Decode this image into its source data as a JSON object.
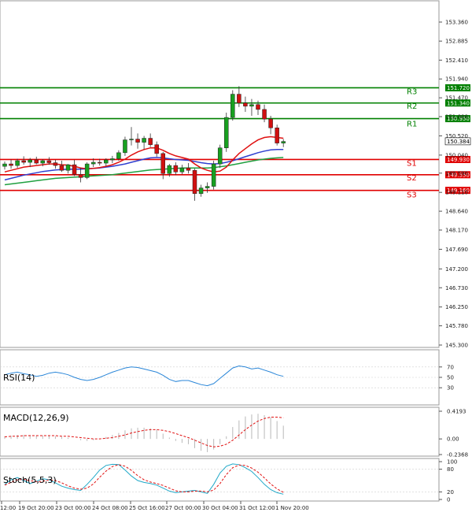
{
  "chart_data": {
    "type": "candlestick",
    "price_axis": {
      "ylim": [
        145.3,
        153.6
      ],
      "ticks": [
        "153.360",
        "152.885",
        "152.410",
        "151.940",
        "151.470",
        "151.000",
        "150.520",
        "150.040",
        "149.590",
        "149.110",
        "148.640",
        "148.170",
        "147.690",
        "147.200",
        "146.730",
        "146.250",
        "145.780",
        "145.300"
      ]
    },
    "time_labels": [
      "12:00",
      "19 Oct 20:00",
      "23 Oct 00:00",
      "24 Oct 08:00",
      "25 Oct 16:00",
      "27 Oct 00:00",
      "30 Oct 04:00",
      "31 Oct 12:00",
      "1 Nov 20:00"
    ],
    "levels": [
      {
        "name": "R3",
        "value": 151.72,
        "label": "151.720",
        "color": "#008000"
      },
      {
        "name": "R2",
        "value": 151.34,
        "label": "151.340",
        "color": "#008000"
      },
      {
        "name": "R1",
        "value": 150.95,
        "label": "150.950",
        "color": "#008000"
      },
      {
        "name": "S1",
        "value": 149.93,
        "label": "149.930",
        "color": "#e00000"
      },
      {
        "name": "S2",
        "value": 149.55,
        "label": "149.550",
        "color": "#e00000"
      },
      {
        "name": "S3",
        "value": 149.16,
        "label": "149.160",
        "color": "#e00000"
      }
    ],
    "current_price": "150.384",
    "candles": [
      [
        149.76,
        149.88,
        149.68,
        149.82
      ],
      [
        149.82,
        149.93,
        149.7,
        149.78
      ],
      [
        149.78,
        149.95,
        149.72,
        149.9
      ],
      [
        149.9,
        150.01,
        149.8,
        149.86
      ],
      [
        149.86,
        149.97,
        149.74,
        149.92
      ],
      [
        149.92,
        150.0,
        149.81,
        149.84
      ],
      [
        149.84,
        149.94,
        149.76,
        149.9
      ],
      [
        149.9,
        149.99,
        149.8,
        149.85
      ],
      [
        149.85,
        149.92,
        149.7,
        149.78
      ],
      [
        149.78,
        149.9,
        149.62,
        149.66
      ],
      [
        149.66,
        149.82,
        149.58,
        149.8
      ],
      [
        149.8,
        149.92,
        149.52,
        149.56
      ],
      [
        149.56,
        149.72,
        149.36,
        149.48
      ],
      [
        149.48,
        149.86,
        149.44,
        149.82
      ],
      [
        149.82,
        149.96,
        149.74,
        149.86
      ],
      [
        149.86,
        149.95,
        149.78,
        149.84
      ],
      [
        149.84,
        149.96,
        149.76,
        149.92
      ],
      [
        149.92,
        150.02,
        149.84,
        149.95
      ],
      [
        149.95,
        150.16,
        149.9,
        150.1
      ],
      [
        150.1,
        150.5,
        150.02,
        150.42
      ],
      [
        150.42,
        150.74,
        150.28,
        150.44
      ],
      [
        150.44,
        150.58,
        150.2,
        150.36
      ],
      [
        150.36,
        150.52,
        150.18,
        150.46
      ],
      [
        150.46,
        150.58,
        150.24,
        150.3
      ],
      [
        150.3,
        150.38,
        150.0,
        150.08
      ],
      [
        150.08,
        150.12,
        149.44,
        149.58
      ],
      [
        149.58,
        149.82,
        149.5,
        149.78
      ],
      [
        149.78,
        149.86,
        149.54,
        149.62
      ],
      [
        149.62,
        149.8,
        149.56,
        149.72
      ],
      [
        149.72,
        149.84,
        149.58,
        149.66
      ],
      [
        149.66,
        149.7,
        148.9,
        149.08
      ],
      [
        149.08,
        149.3,
        149.0,
        149.22
      ],
      [
        149.22,
        149.36,
        149.1,
        149.26
      ],
      [
        149.26,
        149.9,
        149.18,
        149.82
      ],
      [
        149.82,
        150.3,
        149.72,
        150.22
      ],
      [
        150.22,
        151.1,
        150.12,
        150.98
      ],
      [
        150.98,
        151.66,
        150.9,
        151.56
      ],
      [
        151.56,
        151.76,
        151.24,
        151.34
      ],
      [
        151.34,
        151.5,
        151.12,
        151.26
      ],
      [
        151.26,
        151.44,
        151.02,
        151.3
      ],
      [
        151.3,
        151.4,
        151.04,
        151.18
      ],
      [
        151.18,
        151.3,
        150.86,
        150.94
      ],
      [
        150.94,
        151.02,
        150.56,
        150.72
      ],
      [
        150.72,
        150.8,
        150.28,
        150.34
      ],
      [
        150.34,
        150.44,
        150.24,
        150.38
      ]
    ],
    "ma_red": [
      149.62,
      149.66,
      149.7,
      149.74,
      149.76,
      149.78,
      149.8,
      149.82,
      149.82,
      149.8,
      149.79,
      149.76,
      149.72,
      149.7,
      149.71,
      149.73,
      149.76,
      149.8,
      149.86,
      149.94,
      150.04,
      150.12,
      150.18,
      150.22,
      150.22,
      150.16,
      150.08,
      150.02,
      149.98,
      149.94,
      149.82,
      149.72,
      149.66,
      149.62,
      149.64,
      149.74,
      149.92,
      150.08,
      150.2,
      150.32,
      150.42,
      150.48,
      150.5,
      150.48,
      150.46
    ],
    "ma_blue": [
      149.42,
      149.46,
      149.5,
      149.54,
      149.57,
      149.6,
      149.63,
      149.65,
      149.67,
      149.68,
      149.69,
      149.69,
      149.69,
      149.7,
      149.71,
      149.72,
      149.74,
      149.76,
      149.79,
      149.82,
      149.86,
      149.9,
      149.94,
      149.97,
      149.98,
      149.97,
      149.95,
      149.93,
      149.92,
      149.91,
      149.88,
      149.85,
      149.83,
      149.82,
      149.83,
      149.86,
      149.9,
      149.95,
      150.0,
      150.05,
      150.1,
      150.14,
      150.17,
      150.18,
      150.18
    ],
    "ma_green": [
      149.3,
      149.32,
      149.34,
      149.36,
      149.38,
      149.4,
      149.42,
      149.44,
      149.46,
      149.47,
      149.48,
      149.49,
      149.5,
      149.51,
      149.52,
      149.53,
      149.54,
      149.55,
      149.57,
      149.59,
      149.61,
      149.63,
      149.65,
      149.67,
      149.68,
      149.69,
      149.7,
      149.71,
      149.72,
      149.72,
      149.72,
      149.72,
      149.72,
      149.73,
      149.75,
      149.77,
      149.8,
      149.83,
      149.86,
      149.89,
      149.92,
      149.94,
      149.96,
      149.97,
      149.98
    ],
    "rsi": {
      "label": "RSI(14)",
      "ticks": [
        "70",
        "50",
        "30"
      ],
      "values": [
        55,
        58,
        60,
        57,
        55,
        52,
        54,
        58,
        60,
        58,
        55,
        50,
        46,
        44,
        46,
        50,
        55,
        60,
        64,
        68,
        70,
        69,
        66,
        63,
        60,
        54,
        46,
        42,
        44,
        44,
        40,
        36,
        34,
        38,
        48,
        58,
        68,
        72,
        70,
        66,
        68,
        64,
        60,
        55,
        52
      ]
    },
    "macd": {
      "label": "MACD(12,26,9)",
      "ticks": [
        "0.4193",
        "0.00",
        "-0.2368"
      ],
      "hist": [
        0.04,
        0.05,
        0.06,
        0.06,
        0.06,
        0.05,
        0.05,
        0.05,
        0.04,
        0.03,
        0.02,
        0.0,
        -0.02,
        -0.03,
        -0.02,
        0.0,
        0.03,
        0.06,
        0.09,
        0.13,
        0.16,
        0.17,
        0.17,
        0.16,
        0.14,
        0.08,
        0.02,
        -0.03,
        -0.06,
        -0.08,
        -0.14,
        -0.18,
        -0.2,
        -0.16,
        -0.08,
        0.04,
        0.18,
        0.28,
        0.34,
        0.37,
        0.38,
        0.36,
        0.33,
        0.27,
        0.2
      ],
      "signal": [
        0.03,
        0.04,
        0.04,
        0.05,
        0.05,
        0.05,
        0.05,
        0.05,
        0.05,
        0.04,
        0.04,
        0.03,
        0.02,
        0.01,
        0.0,
        0.0,
        0.01,
        0.02,
        0.04,
        0.06,
        0.09,
        0.11,
        0.13,
        0.14,
        0.14,
        0.13,
        0.11,
        0.08,
        0.05,
        0.02,
        -0.02,
        -0.06,
        -0.1,
        -0.12,
        -0.11,
        -0.08,
        -0.02,
        0.06,
        0.14,
        0.21,
        0.27,
        0.31,
        0.33,
        0.33,
        0.32
      ]
    },
    "stoch": {
      "label": "Stoch(5,5,3)",
      "ticks": [
        "100",
        "80",
        "20",
        "0"
      ],
      "k": [
        40,
        52,
        58,
        50,
        42,
        48,
        55,
        52,
        44,
        35,
        30,
        26,
        24,
        40,
        58,
        78,
        90,
        93,
        92,
        78,
        62,
        50,
        45,
        42,
        38,
        30,
        22,
        18,
        20,
        22,
        24,
        20,
        16,
        40,
        70,
        88,
        94,
        92,
        84,
        74,
        58,
        40,
        26,
        18,
        14
      ],
      "d": [
        38,
        45,
        52,
        53,
        50,
        47,
        48,
        52,
        50,
        44,
        36,
        30,
        27,
        30,
        41,
        59,
        75,
        87,
        92,
        88,
        77,
        63,
        52,
        46,
        42,
        37,
        30,
        23,
        20,
        20,
        22,
        22,
        20,
        25,
        42,
        66,
        84,
        91,
        90,
        83,
        72,
        57,
        41,
        28,
        19
      ]
    }
  }
}
